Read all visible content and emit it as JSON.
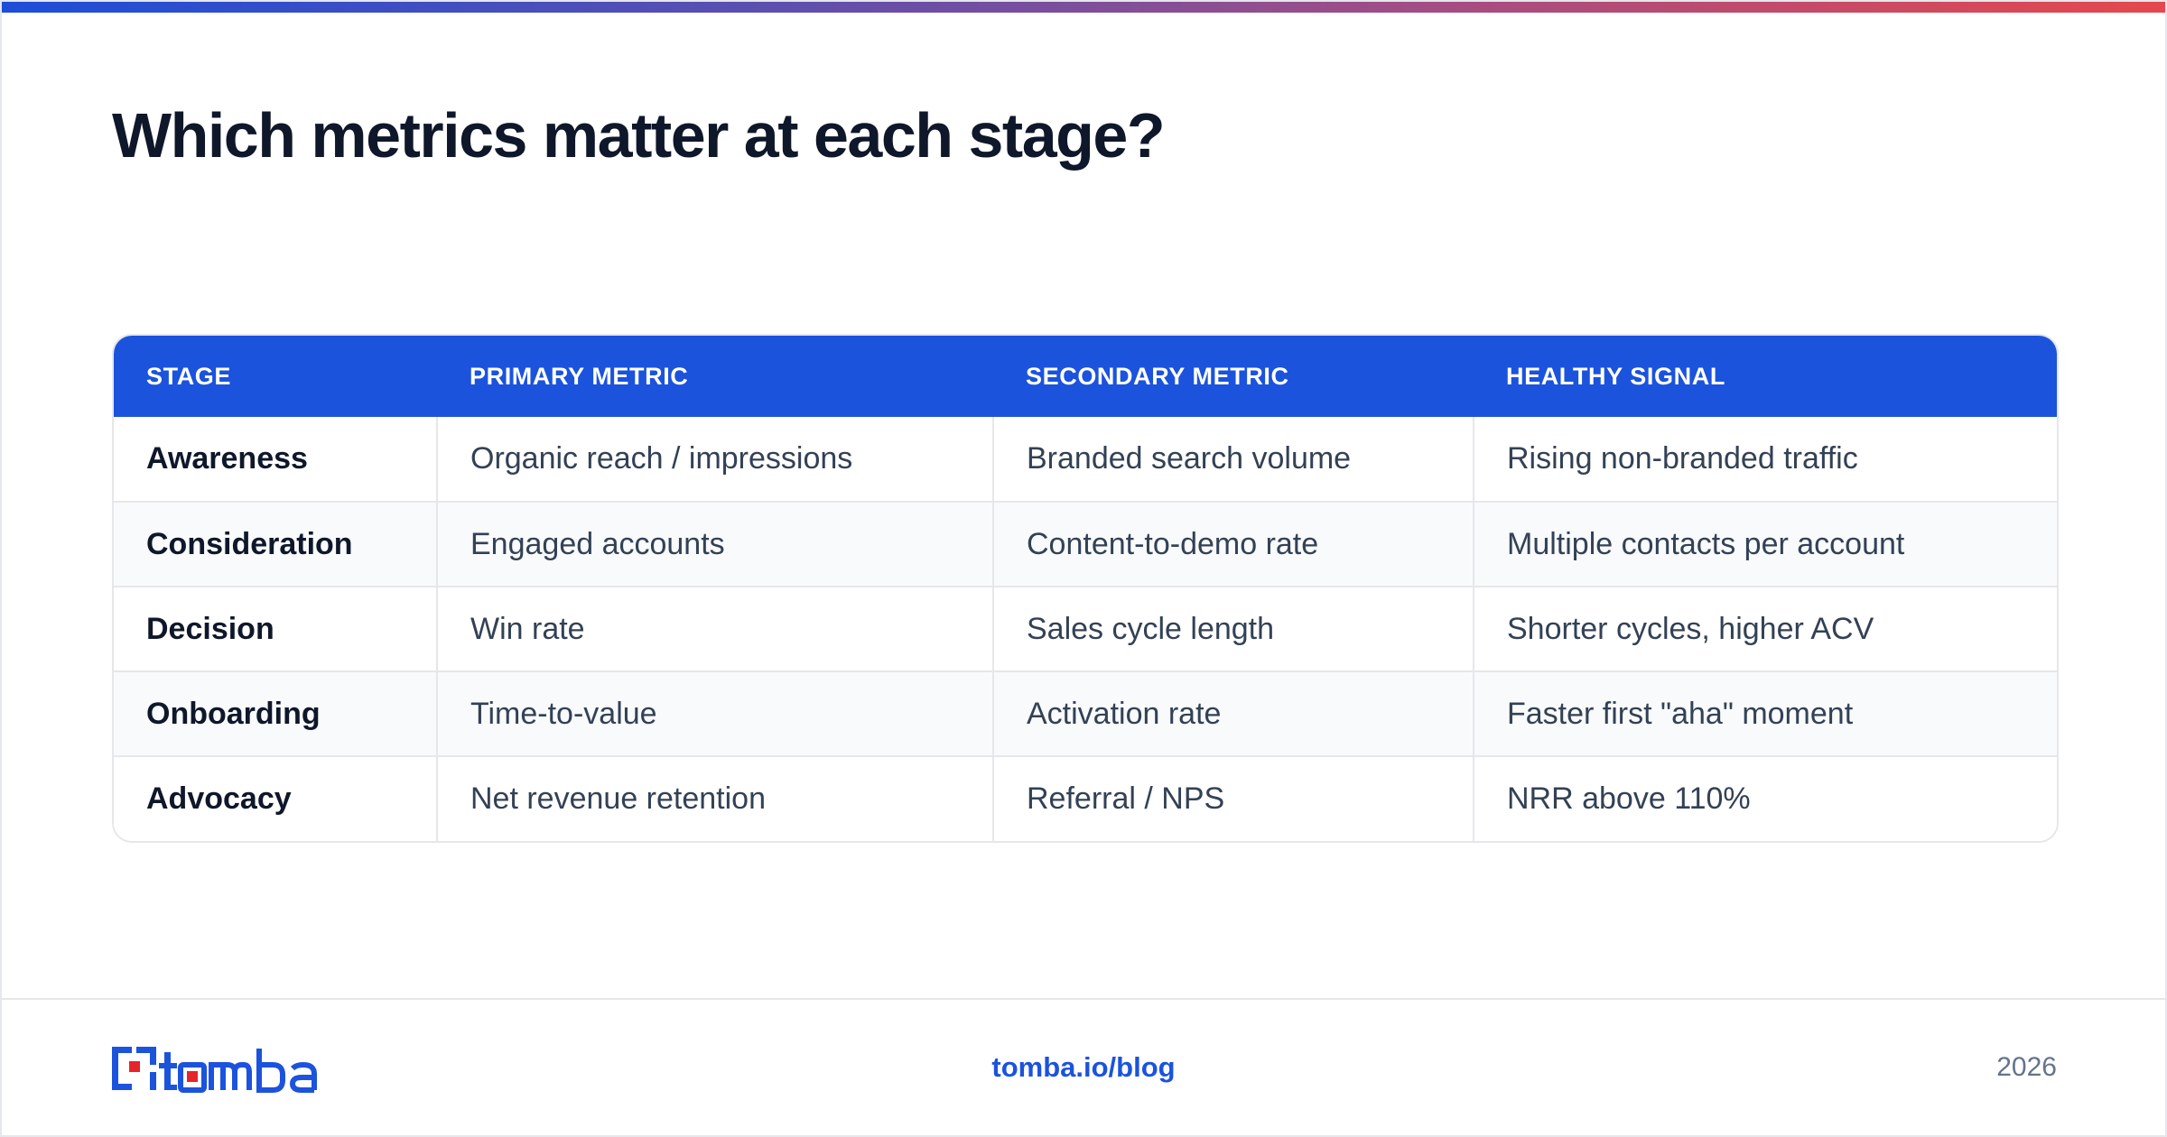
{
  "title": "Which metrics matter at each stage?",
  "colors": {
    "accent": "#1b53dd",
    "logo_red": "#e5252a",
    "header_text": "#ffffff"
  },
  "table": {
    "headers": [
      "STAGE",
      "PRIMARY METRIC",
      "SECONDARY METRIC",
      "HEALTHY SIGNAL"
    ],
    "rows": [
      [
        "Awareness",
        "Organic reach / impressions",
        "Branded search volume",
        "Rising non-branded traffic"
      ],
      [
        "Consideration",
        "Engaged accounts",
        "Content-to-demo rate",
        "Multiple contacts per account"
      ],
      [
        "Decision",
        "Win rate",
        "Sales cycle length",
        "Shorter cycles, higher ACV"
      ],
      [
        "Onboarding",
        "Time-to-value",
        "Activation rate",
        "Faster first \"aha\" moment"
      ],
      [
        "Advocacy",
        "Net revenue retention",
        "Referral / NPS",
        "NRR above 110%"
      ]
    ]
  },
  "footer": {
    "logo_text": "tomba",
    "link": "tomba.io/blog",
    "year": "2026"
  }
}
